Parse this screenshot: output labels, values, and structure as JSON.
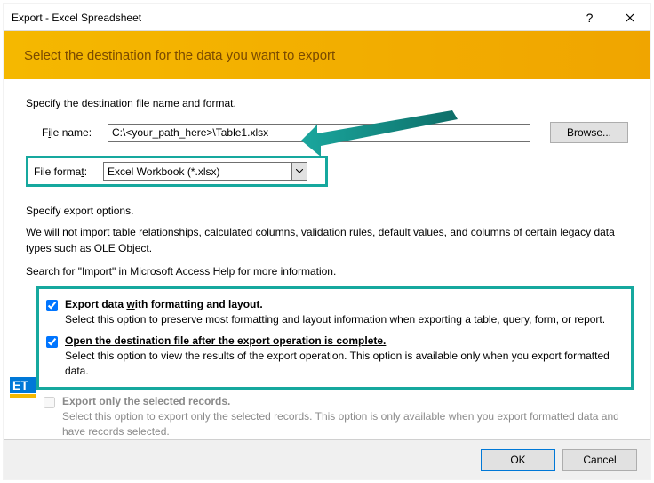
{
  "title": "Export - Excel Spreadsheet",
  "banner": "Select the destination for the data you want to export",
  "spec_label": "Specify the destination file name and format.",
  "filename": {
    "label_pre": "F",
    "label_u": "i",
    "label_post": "le name:",
    "value": "C:\\<your_path_here>\\Table1.xlsx"
  },
  "browse_label": "Browse...",
  "fileformat": {
    "label_pre": "File forma",
    "label_u": "t",
    "label_post": ":",
    "value": "Excel Workbook (*.xlsx)"
  },
  "options_head": "Specify export options.",
  "options_note": "We will not import table relationships, calculated columns, validation rules, default values, and columns of certain legacy data types such as OLE Object.",
  "search_note": "Search for \"Import\" in Microsoft Access Help for more information.",
  "check1": {
    "title_pre": "Export data ",
    "title_u": "w",
    "title_post": "ith formatting and layout.",
    "desc": "Select this option to preserve most formatting and layout information when exporting a table, query, form, or report."
  },
  "check2": {
    "title": "Open the destination file after the export operation is complete.",
    "title_u_char": "A",
    "desc": "Select this option to view the results of the export operation. This option is available only when you export formatted data."
  },
  "check3": {
    "title": "Export only the selected records.",
    "title_u_char": "s",
    "desc": "Select this option to export only the selected records. This option is only available when you export formatted data and have records selected."
  },
  "ok_label": "OK",
  "cancel_label": "Cancel",
  "logo_text": "ET"
}
